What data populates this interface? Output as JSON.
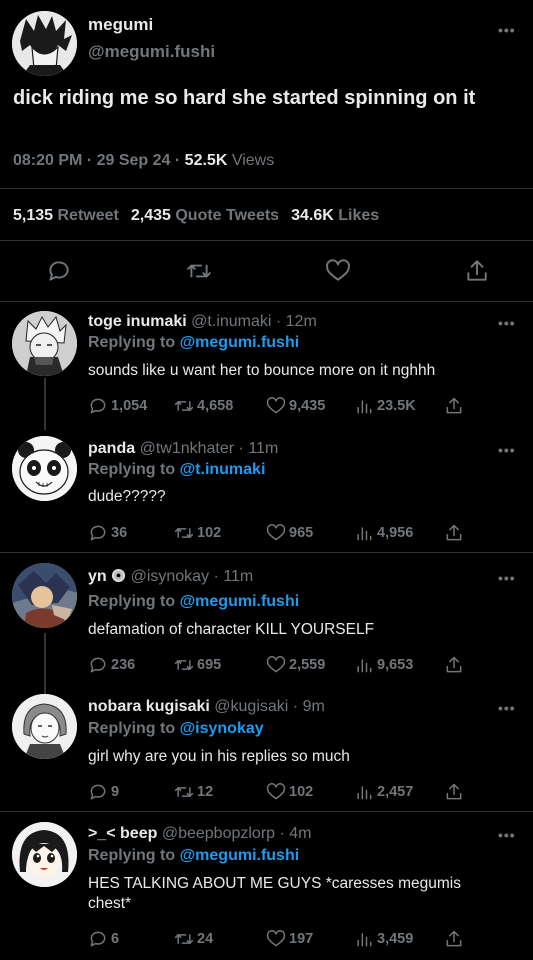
{
  "main_tweet": {
    "name": "megumi",
    "handle": "@megumi.fushi",
    "text": "dick riding me so hard she started spinning on it",
    "time": "08:20 PM",
    "date": "29 Sep 24",
    "views_count": "52.5K",
    "views_label": "Views",
    "retweets_count": "5,135",
    "retweets_label": "Retweet",
    "quotes_count": "2,435",
    "quotes_label": "Quote Tweets",
    "likes_count": "34.6K",
    "likes_label": "Likes",
    "more": "•••",
    "actions": [
      "reply-icon",
      "retweet-icon",
      "like-icon",
      "share-icon"
    ]
  },
  "labels": {
    "replying_to": "Replying to",
    "dot": "·"
  },
  "replies": [
    {
      "name": "toge inumaki",
      "handle": "@t.inumaki",
      "time": "12m",
      "replying_to": "@megumi.fushi",
      "text": "sounds like u want her to bounce more on it nghhh",
      "replies": "1,054",
      "retweets": "4,658",
      "likes": "9,435",
      "views": "23.5K"
    },
    {
      "name": "panda",
      "handle": "@tw1nkhater",
      "time": "11m",
      "replying_to": "@t.inumaki",
      "text": "dude?????",
      "replies": "36",
      "retweets": "102",
      "likes": "965",
      "views": "4,956"
    },
    {
      "name": "yn",
      "name_badge": "disc-icon",
      "handle": "@isynokay",
      "time": "11m",
      "replying_to": "@megumi.fushi",
      "text": "defamation of character KILL YOURSELF",
      "replies": "236",
      "retweets": "695",
      "likes": "2,559",
      "views": "9,653"
    },
    {
      "name": "nobara kugisaki",
      "handle": "@kugisaki",
      "time": "9m",
      "replying_to": "@isynokay",
      "text": "girl why are you in his replies so much",
      "replies": "9",
      "retweets": "12",
      "likes": "102",
      "views": "2,457"
    },
    {
      "name": ">_< beep",
      "handle": "@beepbopzlorp",
      "time": "4m",
      "replying_to": "@megumi.fushi",
      "text": "HES TALKING ABOUT ME GUYS *caresses megumis chest*",
      "replies": "6",
      "retweets": "24",
      "likes": "197",
      "views": "3,459"
    }
  ],
  "colors": {
    "background": "#000000",
    "text": "#e7e9ea",
    "muted": "#71767b",
    "accent": "#1d9bf0",
    "divider": "#2f3336"
  }
}
